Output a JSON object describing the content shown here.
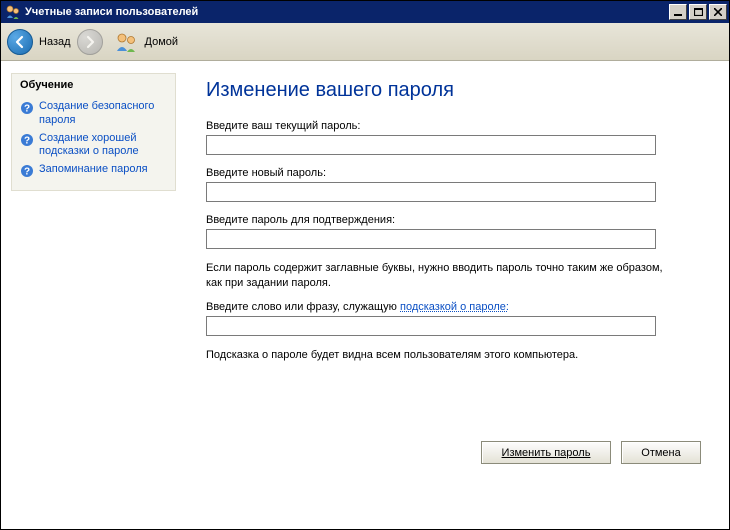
{
  "window": {
    "title": "Учетные записи пользователей"
  },
  "toolbar": {
    "back_label": "Назад",
    "home_label": "Домой"
  },
  "sidebar": {
    "header": "Обучение",
    "items": [
      {
        "label": "Создание безопасного пароля"
      },
      {
        "label": "Создание хорошей подсказки о пароле"
      },
      {
        "label": "Запоминание пароля"
      }
    ]
  },
  "main": {
    "title": "Изменение вашего пароля",
    "current_password_label": "Введите ваш текущий пароль:",
    "new_password_label": "Введите новый пароль:",
    "confirm_password_label": "Введите пароль для подтверждения:",
    "caps_info": "Если пароль содержит заглавные буквы, нужно вводить пароль точно таким же образом, как при задании пароля.",
    "hint_label_prefix": "Введите слово или фразу, служащую ",
    "hint_link_text": "подсказкой о пароле:",
    "hint_info": "Подсказка о пароле будет видна всем пользователям этого компьютера.",
    "current_password_value": "",
    "new_password_value": "",
    "confirm_password_value": "",
    "hint_value": ""
  },
  "buttons": {
    "submit": "Изменить пароль",
    "cancel": "Отмена"
  }
}
